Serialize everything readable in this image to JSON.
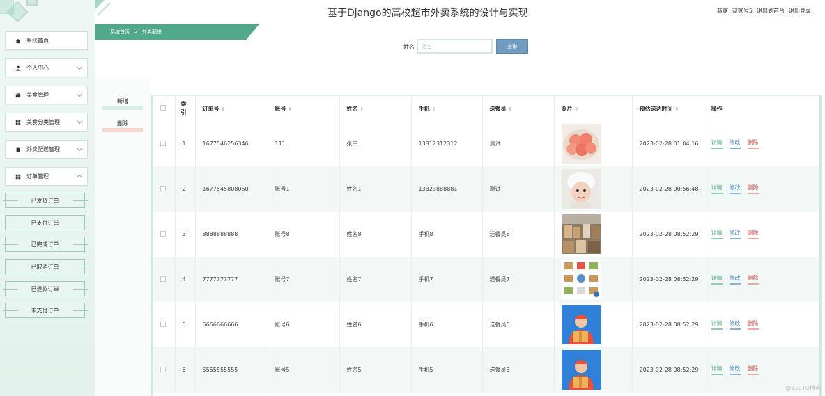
{
  "header": {
    "title": "基于Django的高校超市外卖系统的设计与实现",
    "role": "商家",
    "username": "商家号5",
    "front_link": "退出到前台",
    "logout": "退出登录"
  },
  "sidebar": {
    "items": [
      {
        "label": "系统首页",
        "icon": "home-icon",
        "expandable": false
      },
      {
        "label": "个人中心",
        "icon": "user-icon",
        "expandable": true
      },
      {
        "label": "美食管理",
        "icon": "briefcase-icon",
        "expandable": true
      },
      {
        "label": "美食分类管理",
        "icon": "grid-icon",
        "expandable": true
      },
      {
        "label": "外卖配送管理",
        "icon": "clipboard-icon",
        "expandable": true
      },
      {
        "label": "订单管理",
        "icon": "grid-icon",
        "expandable": true,
        "expanded": true
      }
    ],
    "sub_items": [
      "已发货订单",
      "已支付订单",
      "已完成订单",
      "已取消订单",
      "已退款订单",
      "未支付订单"
    ]
  },
  "breadcrumb": {
    "home": "系统首页",
    "separator": ">",
    "current": "外卖配送"
  },
  "search": {
    "label": "姓名",
    "placeholder": "姓名",
    "button": "查询"
  },
  "actions": {
    "add": "新增",
    "delete": "删除"
  },
  "table": {
    "columns": [
      "索引",
      "订单号",
      "账号",
      "姓名",
      "手机",
      "送餐员",
      "照片",
      "预估送达时间",
      "操作"
    ],
    "index_header_lines": [
      "索",
      "引"
    ],
    "ops": {
      "detail": "详情",
      "edit": "修改",
      "delete": "删除"
    },
    "rows": [
      {
        "index": "1",
        "order_no": "1677546256346",
        "account": "111",
        "name": "张三",
        "phone": "13812312312",
        "courier": "测试",
        "photo": "peaches-photo",
        "eta": "2023-02-28 01:04:16"
      },
      {
        "index": "2",
        "order_no": "1677545808050",
        "account": "账号1",
        "name": "姓名1",
        "phone": "13823888881",
        "courier": "测试",
        "photo": "child-photo",
        "eta": "2023-02-28 00:56:48"
      },
      {
        "index": "3",
        "order_no": "8888888888",
        "account": "账号8",
        "name": "姓名8",
        "phone": "手机8",
        "courier": "送餐员8",
        "photo": "store-photo",
        "eta": "2023-02-28 08:52:29"
      },
      {
        "index": "4",
        "order_no": "7777777777",
        "account": "账号7",
        "name": "姓名7",
        "phone": "手机7",
        "courier": "送餐员7",
        "photo": "boxes-icons-photo",
        "eta": "2023-02-28 08:52:29"
      },
      {
        "index": "5",
        "order_no": "6666666666",
        "account": "账号6",
        "name": "姓名6",
        "phone": "手机6",
        "courier": "送餐员6",
        "photo": "delivery-man-photo",
        "eta": "2023-02-28 08:52:29"
      },
      {
        "index": "6",
        "order_no": "5555555555",
        "account": "账号5",
        "name": "姓名5",
        "phone": "手机5",
        "courier": "送餐员5",
        "photo": "delivery-man-photo",
        "eta": "2023-02-28 08:52:29"
      }
    ]
  },
  "colors": {
    "accent_green": "#4fa98a",
    "edit_blue": "#4d86c4",
    "delete_red": "#d25454",
    "sidebar_bg": "#eef7f3"
  },
  "watermark": "@51CTO博客"
}
